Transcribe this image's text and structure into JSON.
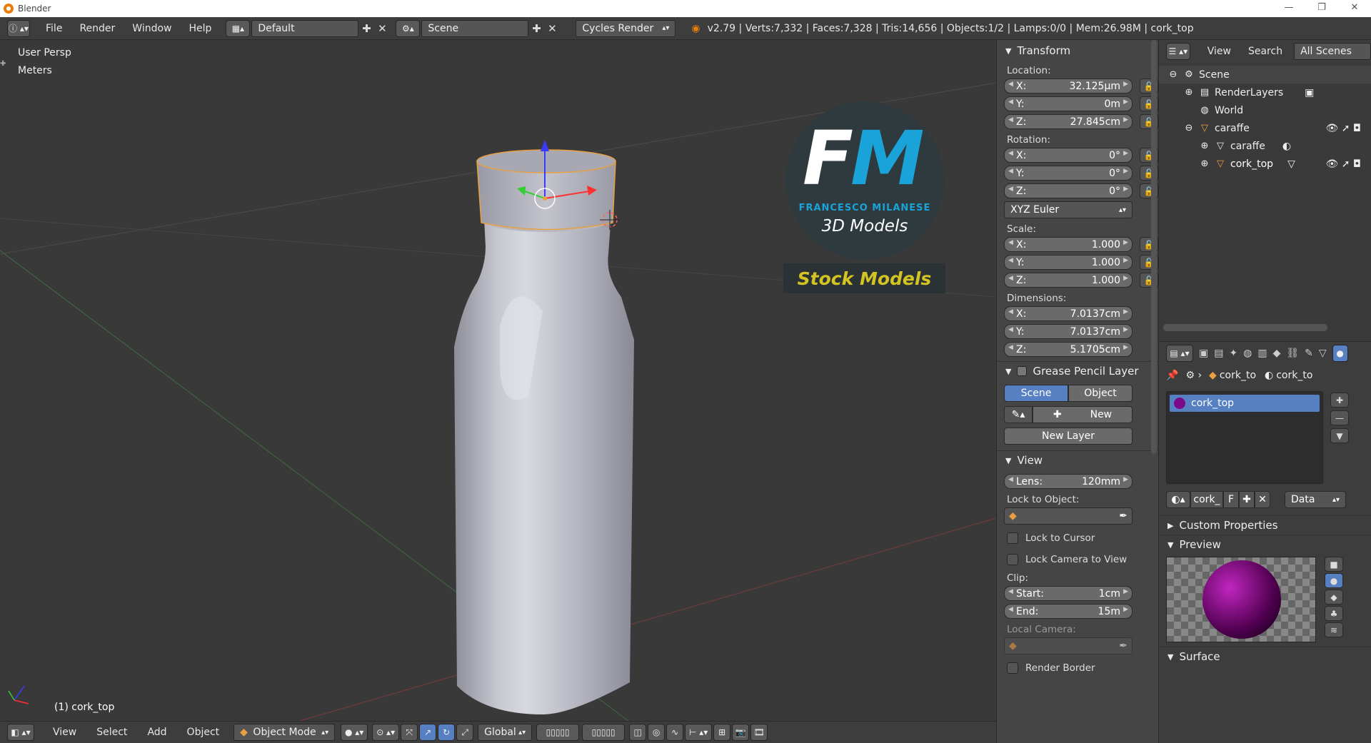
{
  "window": {
    "title": "Blender",
    "min": "—",
    "max": "❐",
    "close": "✕"
  },
  "topbar": {
    "menus": [
      "File",
      "Render",
      "Window",
      "Help"
    ],
    "layout": "Default",
    "scene": "Scene",
    "engine": "Cycles Render",
    "stats": "v2.79 | Verts:7,332 | Faces:7,328 | Tris:14,656 | Objects:1/2 | Lamps:0/0 | Mem:26.98M | cork_top"
  },
  "viewport": {
    "view_name": "User Persp",
    "units": "Meters",
    "object_label": "(1) cork_top",
    "watermark": {
      "letters": "FM",
      "author": "FRANCESCO MILANESE",
      "tagline": "3D Models",
      "banner": "Stock Models"
    }
  },
  "vp_header": {
    "menus": [
      "View",
      "Select",
      "Add",
      "Object"
    ],
    "mode": "Object Mode",
    "orientation": "Global"
  },
  "npanel": {
    "transform_title": "Transform",
    "location_label": "Location:",
    "location": [
      {
        "axis": "X:",
        "value": "32.125μm"
      },
      {
        "axis": "Y:",
        "value": "0m"
      },
      {
        "axis": "Z:",
        "value": "27.845cm"
      }
    ],
    "rotation_label": "Rotation:",
    "rotation": [
      {
        "axis": "X:",
        "value": "0°"
      },
      {
        "axis": "Y:",
        "value": "0°"
      },
      {
        "axis": "Z:",
        "value": "0°"
      }
    ],
    "rotation_mode": "XYZ Euler",
    "scale_label": "Scale:",
    "scale": [
      {
        "axis": "X:",
        "value": "1.000"
      },
      {
        "axis": "Y:",
        "value": "1.000"
      },
      {
        "axis": "Z:",
        "value": "1.000"
      }
    ],
    "dimensions_label": "Dimensions:",
    "dimensions": [
      {
        "axis": "X:",
        "value": "7.0137cm"
      },
      {
        "axis": "Y:",
        "value": "7.0137cm"
      },
      {
        "axis": "Z:",
        "value": "5.1705cm"
      }
    ],
    "grease_title": "Grease Pencil Layer",
    "grease_tabs": [
      "Scene",
      "Object"
    ],
    "new_label": "New",
    "new_layer_label": "New Layer",
    "view_title": "View",
    "lens": {
      "label": "Lens:",
      "value": "120mm"
    },
    "lock_object_label": "Lock to Object:",
    "lock_cursor": "Lock to Cursor",
    "lock_camera": "Lock Camera to View",
    "clip_label": "Clip:",
    "clip_start": {
      "label": "Start:",
      "value": "1cm"
    },
    "clip_end": {
      "label": "End:",
      "value": "15m"
    },
    "local_camera": "Local Camera:",
    "render_border": "Render Border"
  },
  "outliner": {
    "menus": [
      "View",
      "Search"
    ],
    "filter": "All Scenes",
    "items": [
      {
        "name": "Scene",
        "indent": 0
      },
      {
        "name": "RenderLayers",
        "indent": 1
      },
      {
        "name": "World",
        "indent": 1
      },
      {
        "name": "caraffe",
        "indent": 1
      },
      {
        "name": "caraffe",
        "indent": 2
      },
      {
        "name": "cork_top",
        "indent": 2
      }
    ]
  },
  "properties": {
    "breadcrumb": [
      "cork_to",
      "cork_to"
    ],
    "slot": "cork_top",
    "material_name": "cork_",
    "fake_user": "F",
    "link": "Data",
    "custom_props": "Custom Properties",
    "preview": "Preview",
    "surface": "Surface"
  },
  "colors": {
    "accent": "#5680c2",
    "viewport": "#393939",
    "selected": "#e8a040",
    "watermark_blue": "#1aa3d9",
    "banner_yellow": "#d4c421"
  }
}
